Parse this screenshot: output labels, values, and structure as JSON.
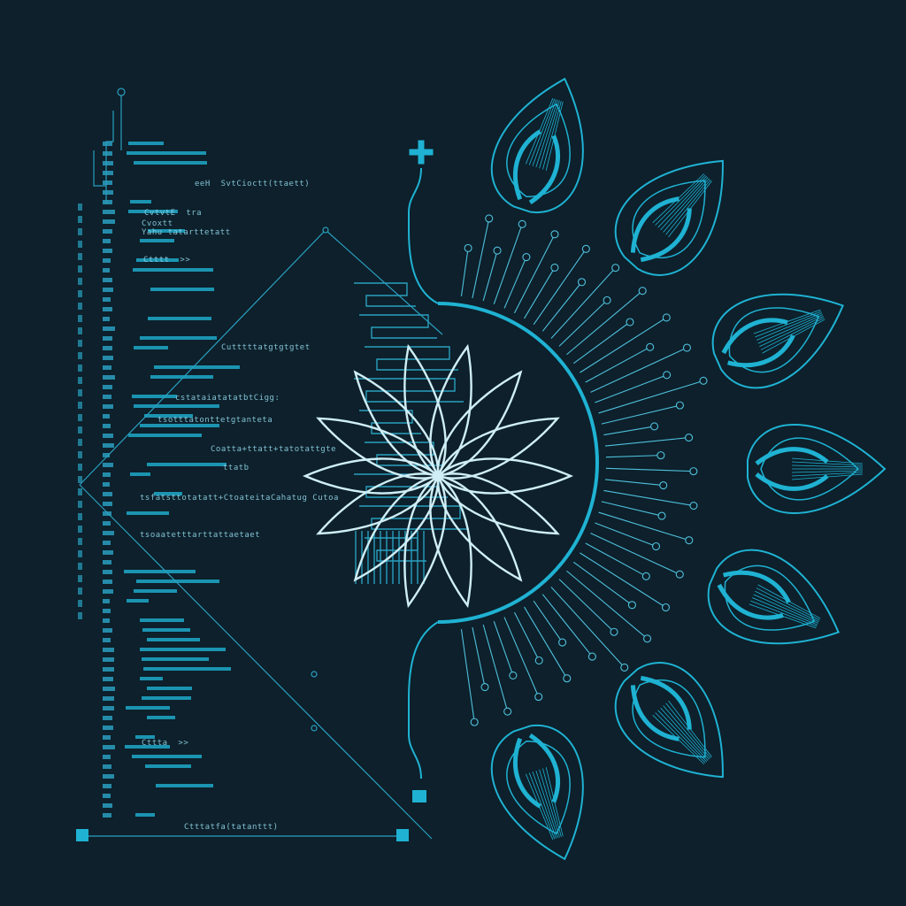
{
  "artwork": {
    "style": "blueprint line art",
    "subject": "code listing, wireframe triangle and circuit flower",
    "colors": {
      "background": "#0d202b",
      "primary": "#1fb2d3",
      "secondary": "#2a9fbf",
      "highlight": "#cfeef5",
      "text": "#8fd3e6"
    }
  },
  "code_lines": [
    "eeH  SvtCioctt(ttaett)",
    "CvtvtE  tra",
    "Cvoxtt",
    "Yahu tatarttetatt",
    "Ctttt  >>",
    "Cutttttatgtgtgtet",
    "cstataiatatatbtCigg:",
    "tsotttatonttetgtanteta",
    "Coatta+ttatt+tatotattgte",
    "ttatb",
    "tsfatsttotatatt+CtoateitaCahatug Cutoa",
    "tsoaatetttarttattaetaet",
    "Cttta  >>",
    "Ctttatfa(tatanttt)"
  ]
}
